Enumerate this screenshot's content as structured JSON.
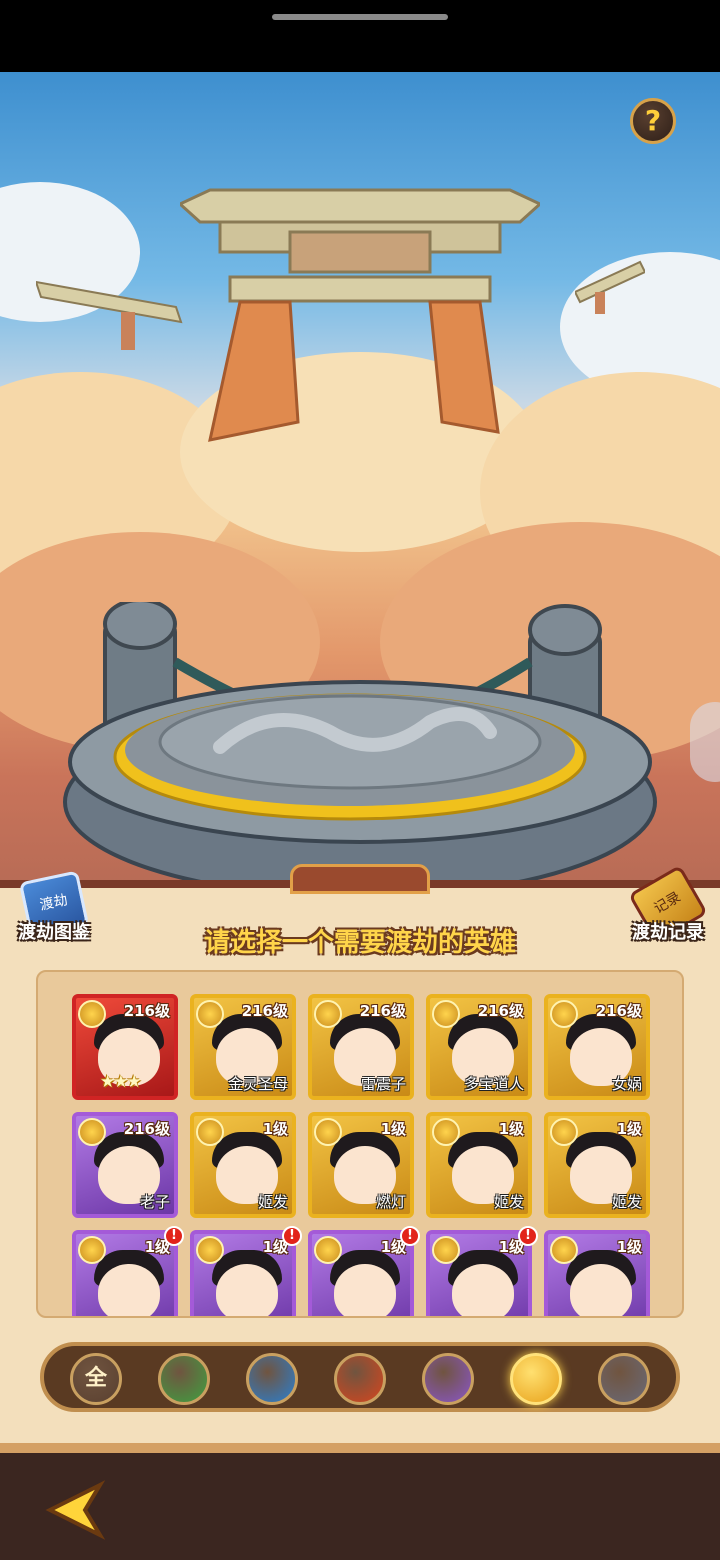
{
  "help_button": {
    "label": "?"
  },
  "title": "请选择一个需要渡劫的英雄",
  "left_button": {
    "label": "渡劫图鉴",
    "icon": "book-icon",
    "book_text": "渡劫"
  },
  "right_button": {
    "label": "渡劫记录",
    "icon": "scroll-icon",
    "scroll_text": "记录"
  },
  "heroes": [
    {
      "level": "216级",
      "name": "",
      "stars": "★★★",
      "frame": "red",
      "alert": ""
    },
    {
      "level": "216级",
      "name": "金灵圣母",
      "stars": "",
      "frame": "gold",
      "alert": ""
    },
    {
      "level": "216级",
      "name": "雷震子",
      "stars": "",
      "frame": "gold",
      "alert": ""
    },
    {
      "level": "216级",
      "name": "多宝道人",
      "stars": "",
      "frame": "gold",
      "alert": ""
    },
    {
      "level": "216级",
      "name": "女娲",
      "stars": "",
      "frame": "gold",
      "alert": ""
    },
    {
      "level": "216级",
      "name": "老子",
      "stars": "",
      "frame": "purple",
      "alert": ""
    },
    {
      "level": "1级",
      "name": "姬发",
      "stars": "",
      "frame": "gold",
      "alert": ""
    },
    {
      "level": "1级",
      "name": "燃灯",
      "stars": "",
      "frame": "gold",
      "alert": ""
    },
    {
      "level": "1级",
      "name": "姬发",
      "stars": "",
      "frame": "gold",
      "alert": ""
    },
    {
      "level": "1级",
      "name": "姬发",
      "stars": "",
      "frame": "gold",
      "alert": ""
    },
    {
      "level": "1级",
      "name": "",
      "stars": "",
      "frame": "purple",
      "alert": "!"
    },
    {
      "level": "1级",
      "name": "",
      "stars": "",
      "frame": "purple",
      "alert": "!"
    },
    {
      "level": "1级",
      "name": "",
      "stars": "",
      "frame": "purple",
      "alert": "!"
    },
    {
      "level": "1级",
      "name": "",
      "stars": "",
      "frame": "purple",
      "alert": "!"
    },
    {
      "level": "1级",
      "name": "",
      "stars": "",
      "frame": "purple",
      "alert": ""
    }
  ],
  "filters": [
    {
      "label": "全",
      "icon": "all-filter-icon",
      "color": "#5a4030"
    },
    {
      "label": "",
      "icon": "wood-element-icon",
      "color": "#3fa040"
    },
    {
      "label": "",
      "icon": "water-element-icon",
      "color": "#2a7fd0"
    },
    {
      "label": "",
      "icon": "fire-element-icon",
      "color": "#d7461e"
    },
    {
      "label": "",
      "icon": "moon-element-icon",
      "color": "#8a56c8"
    },
    {
      "label": "",
      "icon": "sun-element-icon",
      "color": "#e8a11a"
    },
    {
      "label": "",
      "icon": "void-element-icon",
      "color": "#6a6a78"
    }
  ],
  "selected_filter": "sun-element-icon",
  "colors": {
    "title": "#ffd54a",
    "panel": "#f3dfbc",
    "accent_gold": "#eab21f"
  }
}
